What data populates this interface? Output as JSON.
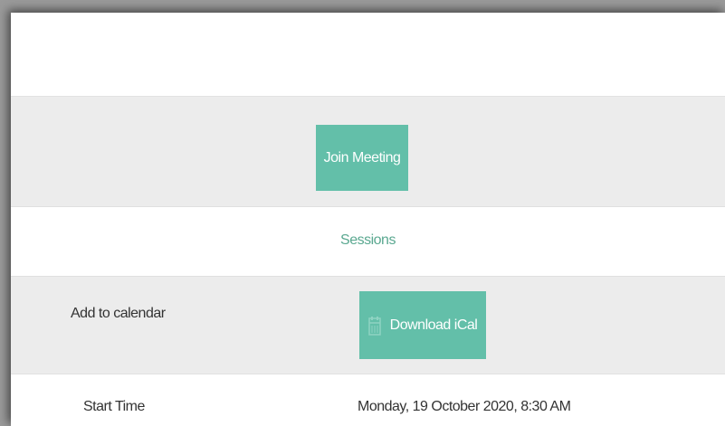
{
  "meeting": {
    "join_label": "Join Meeting"
  },
  "sessions": {
    "heading": "Sessions"
  },
  "calendar": {
    "label": "Add to calendar",
    "download_label": "Download iCal",
    "download_icon": "calendar-icon"
  },
  "start": {
    "label": "Start Time",
    "value": "Monday, 19 October 2020, 8:30 AM"
  },
  "colors": {
    "button": "#63bfa9",
    "accent_text": "#5aa890",
    "row_alt": "#ececec"
  }
}
